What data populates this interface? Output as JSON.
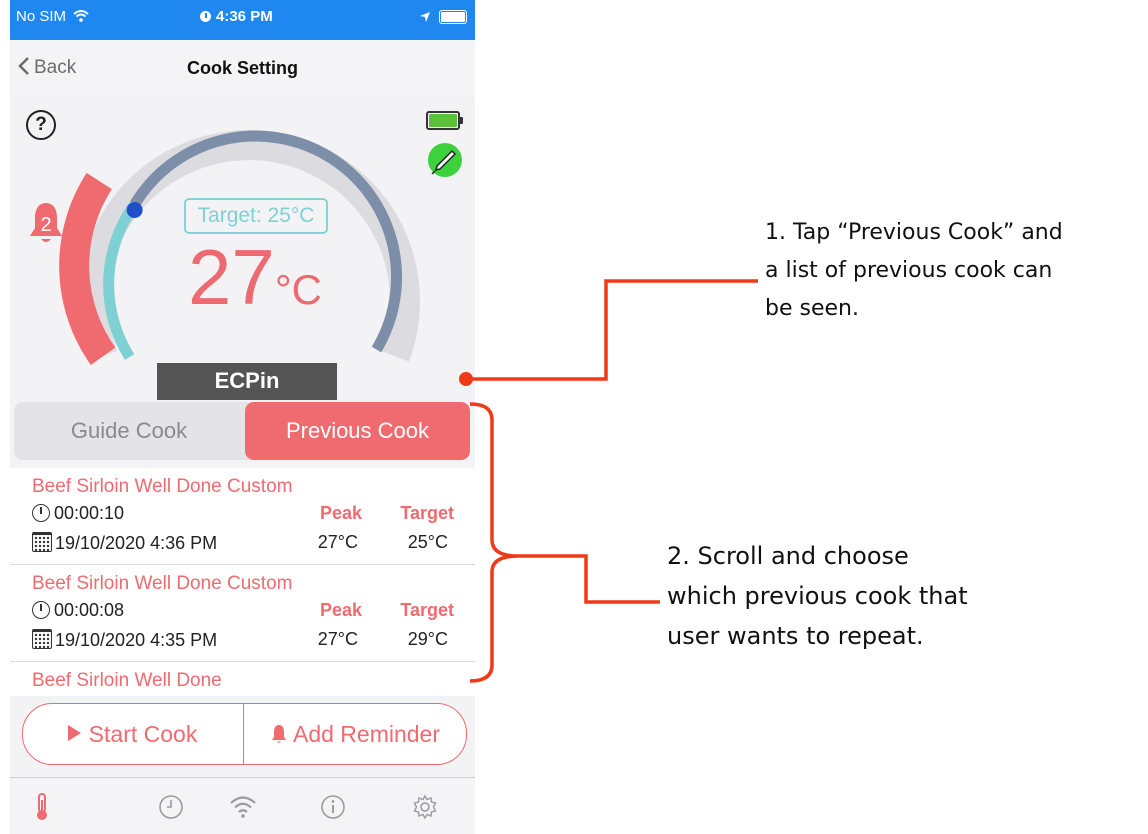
{
  "status_bar": {
    "carrier": "No SIM",
    "time": "4:36 PM"
  },
  "nav": {
    "back_label": "Back",
    "title": "Cook Setting"
  },
  "gauge": {
    "help_symbol": "?",
    "alarm_count": "2",
    "target_text": "Target: 25°C",
    "temp_value": "27",
    "temp_unit": "°C",
    "probe_name": "ECPin",
    "colors": {
      "hot_arc": "#ef6b70",
      "current_arc": "#7fd0d2",
      "target_arc": "#7d8ea8",
      "track": "#dcdce0",
      "marker": "#1f4fc8"
    }
  },
  "tabs": {
    "guide": "Guide Cook",
    "previous": "Previous Cook",
    "selected": "Previous Cook"
  },
  "cook_list": {
    "items": [
      {
        "name": "Beef Sirloin Well Done Custom",
        "duration": "00:00:10",
        "date": "19/10/2020 4:36 PM",
        "peak_label": "Peak",
        "target_label": "Target",
        "peak": "27°C",
        "target": "25°C"
      },
      {
        "name": "Beef Sirloin Well Done Custom",
        "duration": "00:00:08",
        "date": "19/10/2020 4:35 PM",
        "peak_label": "Peak",
        "target_label": "Target",
        "peak": "27°C",
        "target": "29°C"
      },
      {
        "name": "Beef Sirloin Well Done"
      }
    ]
  },
  "actions": {
    "start": "Start Cook",
    "reminder": "Add Reminder"
  },
  "tab_bar": {
    "icons": [
      "thermometer-icon",
      "clock-icon",
      "wifi-icon",
      "info-icon",
      "gear-icon"
    ]
  },
  "annotations": {
    "note1": [
      "1. Tap “Previous Cook” and",
      "a list of previous cook can",
      "be seen."
    ],
    "note2": [
      "2. Scroll and choose",
      "which previous cook that",
      "user wants to repeat."
    ],
    "line_color": "#f03a17"
  },
  "accent_color": "#ef6b70"
}
